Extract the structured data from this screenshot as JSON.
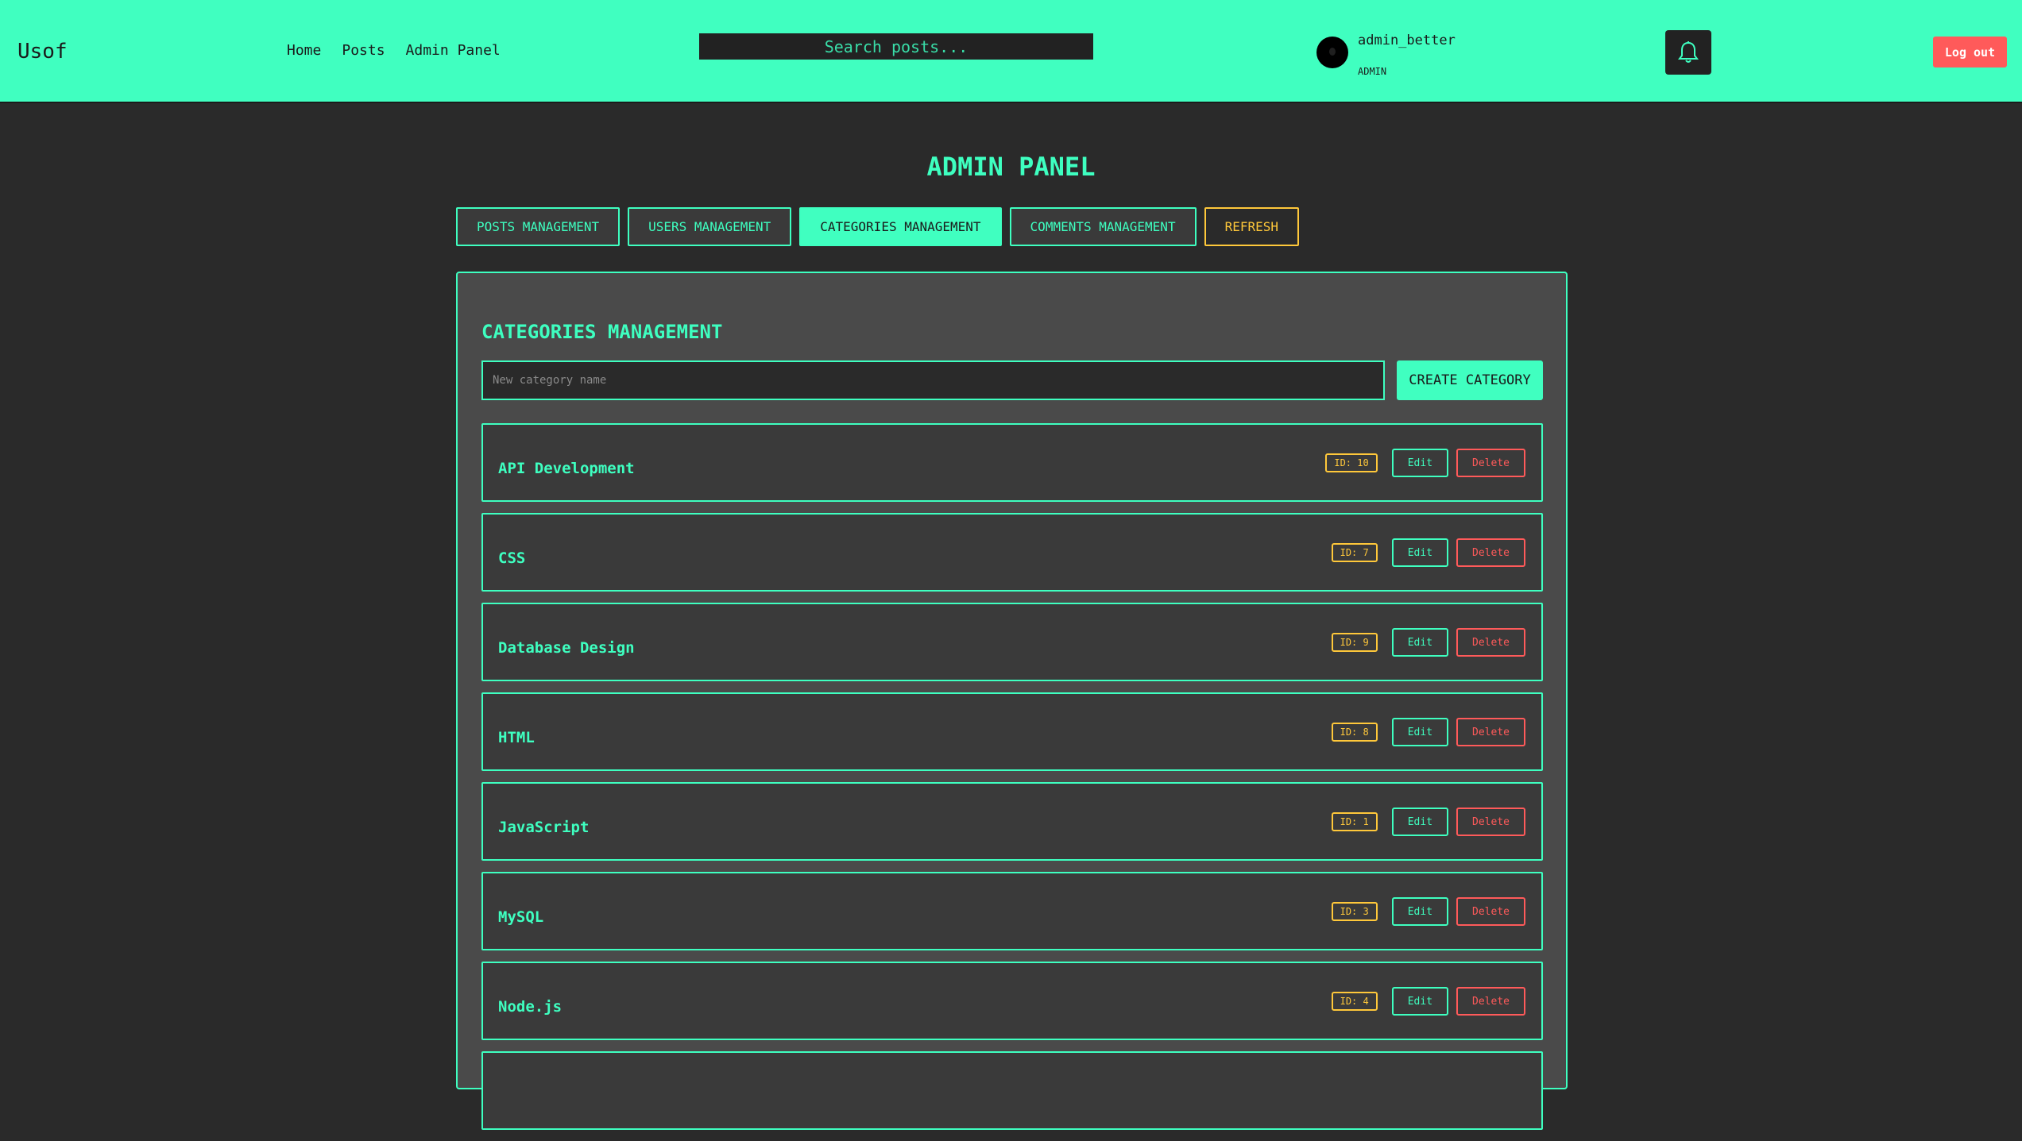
{
  "header": {
    "logo": "Usof",
    "nav": [
      "Home",
      "Posts",
      "Admin Panel"
    ],
    "search_placeholder": "Search posts...",
    "user": {
      "name": "admin_better",
      "role": "ADMIN"
    },
    "bell_icon": "bell-icon",
    "logout_label": "Log out"
  },
  "page": {
    "title": "ADMIN PANEL",
    "tabs": [
      {
        "label": "POSTS MANAGEMENT",
        "active": false
      },
      {
        "label": "USERS MANAGEMENT",
        "active": false
      },
      {
        "label": "CATEGORIES MANAGEMENT",
        "active": true
      },
      {
        "label": "COMMENTS MANAGEMENT",
        "active": false
      },
      {
        "label": "REFRESH",
        "active": false
      }
    ]
  },
  "panel": {
    "title": "CATEGORIES MANAGEMENT",
    "new_placeholder": "New category name",
    "create_label": "CREATE CATEGORY",
    "edit_label": "Edit",
    "delete_label": "Delete",
    "categories": [
      {
        "name": "API Development",
        "id": "ID: 10"
      },
      {
        "name": "CSS",
        "id": "ID: 7"
      },
      {
        "name": "Database Design",
        "id": "ID: 9"
      },
      {
        "name": "HTML",
        "id": "ID: 8"
      },
      {
        "name": "JavaScript",
        "id": "ID: 1"
      },
      {
        "name": "MySQL",
        "id": "ID: 3"
      },
      {
        "name": "Node.js",
        "id": "ID: 4"
      }
    ]
  },
  "colors": {
    "accent": "#40ffc0",
    "background": "#2a2a2a",
    "panel": "#4a4a4a",
    "warning": "#ffc83a",
    "danger": "#ff5a5a"
  }
}
